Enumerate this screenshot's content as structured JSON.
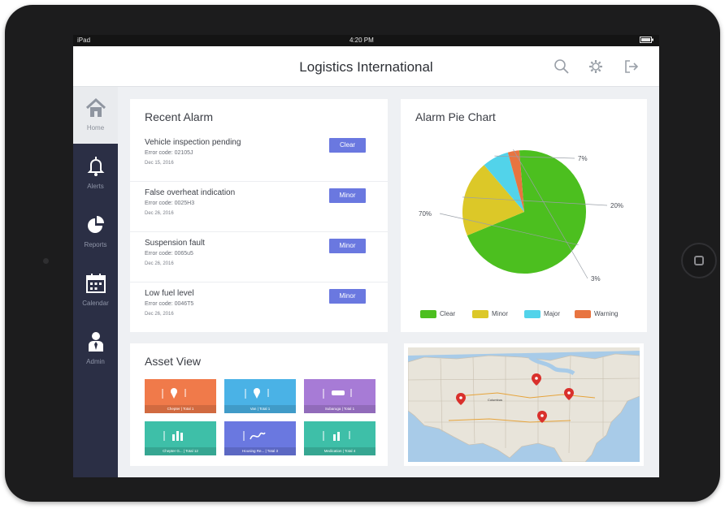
{
  "status_bar": {
    "left": "iPad",
    "time": "4:20 PM",
    "right": ""
  },
  "header": {
    "title": "Logistics International"
  },
  "sidebar": {
    "items": [
      {
        "label": "Home",
        "icon": "home-icon",
        "active": true
      },
      {
        "label": "Alerts",
        "icon": "bell-icon",
        "active": false
      },
      {
        "label": "Reports",
        "icon": "pie-chart-icon",
        "active": false
      },
      {
        "label": "Calendar",
        "icon": "calendar-icon",
        "active": false
      },
      {
        "label": "Admin",
        "icon": "user-icon",
        "active": false
      }
    ]
  },
  "recent_alarm": {
    "title": "Recent Alarm",
    "items": [
      {
        "title": "Vehicle inspection pending",
        "code": "Error code: 02105J",
        "date": "Dec 15, 2016",
        "button": "Clear"
      },
      {
        "title": "False overheat indication",
        "code": "Error code: 0025H3",
        "date": "Dec 26, 2016",
        "button": "Minor"
      },
      {
        "title": "Suspension fault",
        "code": "Error code: 0065u5",
        "date": "Dec 26, 2016",
        "button": "Minor"
      },
      {
        "title": "Low fuel level",
        "code": "Error code: 0046T5",
        "date": "Dec 26, 2016",
        "button": "Minor"
      }
    ]
  },
  "alarm_chart": {
    "title": "Alarm Pie Chart",
    "labels": [
      "70%",
      "7%",
      "20%",
      "3%"
    ]
  },
  "chart_data": {
    "type": "pie",
    "title": "Alarm Pie Chart",
    "categories": [
      "Clear",
      "Minor",
      "Major",
      "Warning"
    ],
    "values": [
      70,
      20,
      7,
      3
    ],
    "colors": [
      "#4cbf1f",
      "#dcc828",
      "#52d3ea",
      "#e87440"
    ],
    "legend": "bottom"
  },
  "asset_view": {
    "title": "Asset View",
    "tiles": [
      {
        "color": "#f07a4a",
        "label": "Chepter | Total 1"
      },
      {
        "color": "#4ab2e6",
        "label": "Van | Total 1"
      },
      {
        "color": "#a77bd6",
        "label": "Subaruga | Total 1"
      },
      {
        "color": "#3ebfa8",
        "label": "Chepter G... | Total 12"
      },
      {
        "color": "#6a78e0",
        "label": "Housing Re... | Total 3"
      },
      {
        "color": "#3ebfa8",
        "label": "Medication | Total 4"
      }
    ]
  },
  "map": {
    "city_label": "Columbus"
  }
}
